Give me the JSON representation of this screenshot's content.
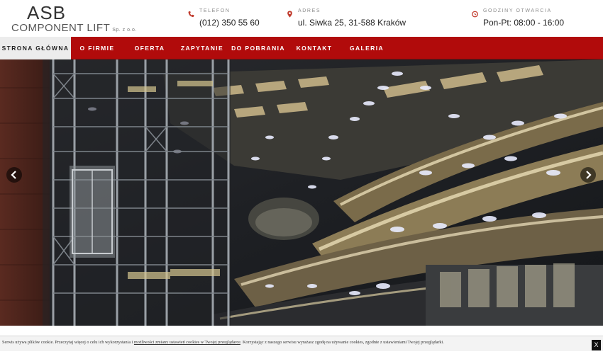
{
  "logo": {
    "brand": "ASB",
    "name": "COMPONENT LIFT",
    "suffix": "Sp. z o.o."
  },
  "contacts": {
    "phone": {
      "label": "TELEFON",
      "value": "(012) 350 55 60",
      "icon": "phone-icon"
    },
    "address": {
      "label": "ADRES",
      "value": "ul. Siwka 25, 31-588 Kraków",
      "icon": "map-pin-icon"
    },
    "hours": {
      "label": "GODZINY OTWARCIA",
      "value": "Pon-Pt: 08:00 - 16:00",
      "icon": "clock-icon"
    }
  },
  "nav": {
    "items": [
      {
        "label": "STRONA GŁÓWNA",
        "active": true
      },
      {
        "label": "O FIRMIE"
      },
      {
        "label": "OFERTA"
      },
      {
        "label": "ZAPYTANIE"
      },
      {
        "label": "DO POBRANIA"
      },
      {
        "label": "KONTAKT"
      },
      {
        "label": "GALERIA"
      }
    ]
  },
  "slider": {
    "prev_icon": "chevron-left-icon",
    "next_icon": "chevron-right-icon"
  },
  "cookie": {
    "text_before": "Serwis używa plików cookie. Przeczytaj więcej o celu ich wykorzystania i ",
    "link_text": "możliwości zmiany ustawień cookies w Twojej przeglądarce",
    "text_after": ". Korzystając z naszego serwisu wyrażasz zgodę na używanie cookies, zgodnie z ustawieniami Twojej przeglądarki.",
    "close_label": "X"
  },
  "colors": {
    "nav_bg": "#b10b0b",
    "icon_red": "#c0392b",
    "active_bg": "#ececec"
  }
}
